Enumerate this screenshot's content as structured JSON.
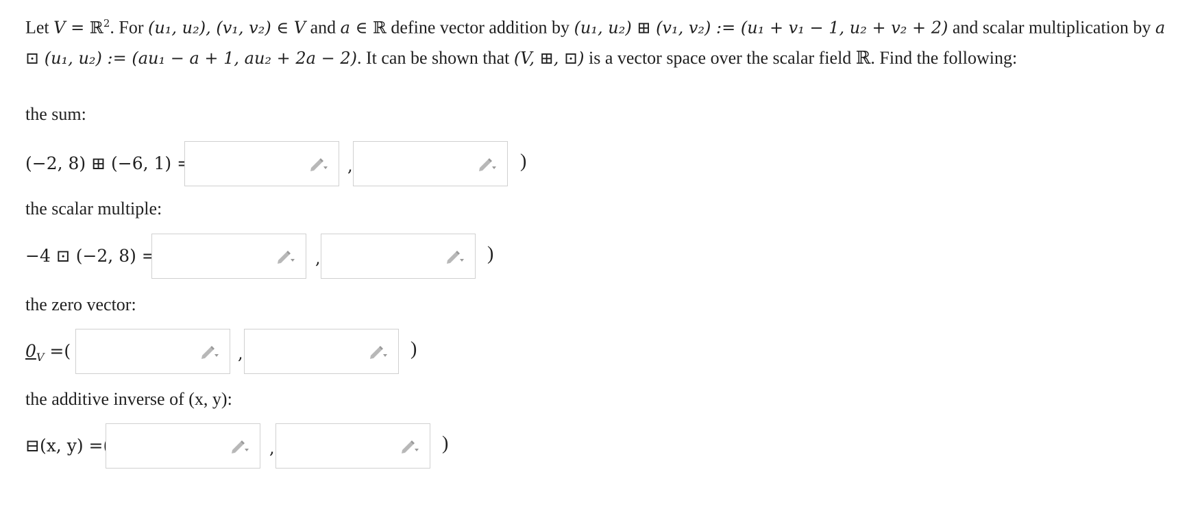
{
  "intro": {
    "p1_let": "Let ",
    "p1_V": "V",
    "p1_eqR": " = ℝ",
    "p1_sup2": "2",
    "p1_for": ". For ",
    "p1_pair": "(u₁, u₂), (v₁, v₂) ∈ ",
    "p1_V2": "V",
    "p1_and": " and ",
    "p1_a": "a",
    "p1_inR": " ∈ ℝ",
    "p1_define": " define vector addition by ",
    "p1_add_def": "(u₁, u₂) ⊞ (v₁, v₂) := (u₁ + v₁ − 1, u₂ + v₂ + 2)",
    "p1_and_scalar": " and scalar multiplication by ",
    "p1_mul_def": "a ⊡ (u₁, u₂) := (au₁ − a + 1, au₂ + 2a − 2)",
    "p1_shown": ". It can be shown that ",
    "p1_space": "(V, ⊞, ⊡)",
    "p1_rest": " is a vector space over the scalar field ℝ. Find the following:"
  },
  "sections": [
    {
      "label": "the sum:",
      "lhs": "(−2, 8) ⊞ (−6, 1) =(",
      "sep": ",",
      "close": ")"
    },
    {
      "label": "the scalar multiple:",
      "lhs": "−4 ⊡ (−2, 8) =(",
      "sep": ",",
      "close": ")"
    },
    {
      "label": "the zero vector:",
      "lhs_main": "0",
      "lhs_sub": "V",
      "lhs_tail": " =(",
      "sep": ",",
      "close": ")"
    },
    {
      "label": "the additive inverse of (x, y):",
      "lhs": "⊟(x, y) =(",
      "sep": ",",
      "close": ")"
    }
  ],
  "icons": {
    "pencil": "pencil-dropdown-icon"
  },
  "colors": {
    "border": "#d0d0d0",
    "text": "#1f1f1f"
  }
}
